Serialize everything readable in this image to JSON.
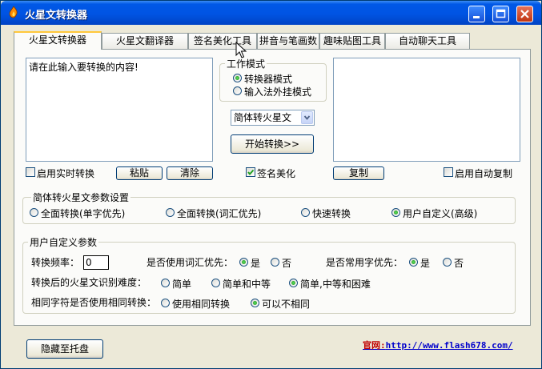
{
  "window": {
    "title": "火星文转换器"
  },
  "tabs": [
    {
      "label": "火星文转换器",
      "active": true
    },
    {
      "label": "火星文翻译器",
      "active": false
    },
    {
      "label": "签名美化工具",
      "active": false
    },
    {
      "label": "拼音与笔画数",
      "active": false
    },
    {
      "label": "趣味贴图工具",
      "active": false
    },
    {
      "label": "自动聊天工具",
      "active": false
    }
  ],
  "converter": {
    "input_text": "请在此输入要转换的内容!",
    "output_text": "",
    "work_mode": {
      "title": "工作模式",
      "options": [
        "转换器模式",
        "输入法外挂模式"
      ],
      "selected": 0
    },
    "direction_select": "简体转火星文",
    "start_button": "开始转换>>",
    "realtime_label": "启用实时转换",
    "realtime_checked": false,
    "paste_button": "粘贴",
    "clear_button": "清除",
    "signature_label": "签名美化",
    "signature_checked": true,
    "copy_button": "复制",
    "autocopy_label": "启用自动复制",
    "autocopy_checked": false
  },
  "params": {
    "title": "简体转火星文参数设置",
    "options": [
      "全面转换(单字优先)",
      "全面转换(词汇优先)",
      "快速转换",
      "用户自定义(高级)"
    ],
    "selected": 3
  },
  "custom": {
    "title": "用户自定义参数",
    "freq_label": "转换频率：",
    "freq_value": "0",
    "vocab_label": "是否使用词汇优先：",
    "vocab_options": [
      "是",
      "否"
    ],
    "vocab_selected": 0,
    "common_label": "是否常用字优先：",
    "common_options": [
      "是",
      "否"
    ],
    "common_selected": 0,
    "difficulty_label": "转换后的火星文识别难度：",
    "difficulty_options": [
      "简单",
      "简单和中等",
      "简单,中等和困难"
    ],
    "difficulty_selected": 2,
    "same_char_label": "相同字符是否使用相同转换：",
    "same_char_options": [
      "使用相同转换",
      "可以不相同"
    ],
    "same_char_selected": 1
  },
  "footer": {
    "tray_button": "隐藏至托盘",
    "site_prefix": "官网:",
    "site_url": "http://www.flash678.com/"
  },
  "colors": {
    "titlebar": "#0054e3",
    "window_bg": "#ECE9D8",
    "panel_bg": "#fbfbf9",
    "active_tab_accent": "#ffc83c",
    "radio_on": "#21a121",
    "link": "#0000cc"
  }
}
